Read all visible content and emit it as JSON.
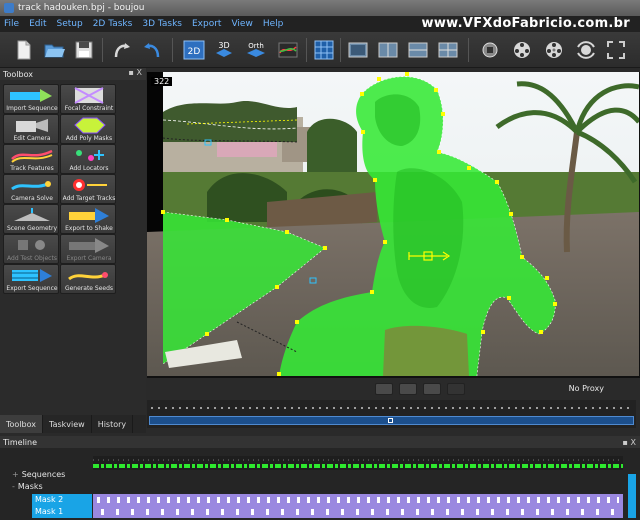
{
  "window": {
    "title": "track hadouken.bpj - boujou",
    "watermark": "www.VFXdoFabricio.com.br"
  },
  "menu": [
    "File",
    "Edit",
    "Setup",
    "2D Tasks",
    "3D Tasks",
    "Export",
    "View",
    "Help"
  ],
  "toolbar": {
    "buttons": [
      {
        "name": "new-icon",
        "label": ""
      },
      {
        "name": "open-icon",
        "label": ""
      },
      {
        "name": "save-icon",
        "label": ""
      },
      {
        "name": "undo-icon",
        "label": ""
      },
      {
        "name": "redo-icon",
        "label": ""
      },
      {
        "name": "view-2d-icon",
        "label": "2D"
      },
      {
        "name": "view-3d-icon",
        "label": "3D"
      },
      {
        "name": "view-orth-icon",
        "label": "Orth"
      },
      {
        "name": "graph-view-icon",
        "label": ""
      },
      {
        "name": "grid-view-icon",
        "label": ""
      },
      {
        "name": "layout-1-icon",
        "label": ""
      },
      {
        "name": "layout-2-icon",
        "label": ""
      },
      {
        "name": "layout-3-icon",
        "label": ""
      },
      {
        "name": "layout-4-icon",
        "label": ""
      },
      {
        "name": "camera-tool-icon",
        "label": ""
      },
      {
        "name": "film-reel-icon",
        "label": ""
      },
      {
        "name": "film-reel-2-icon",
        "label": ""
      },
      {
        "name": "orbit-icon",
        "label": ""
      },
      {
        "name": "frame-icon",
        "label": ""
      }
    ]
  },
  "toolbox": {
    "title": "Toolbox",
    "controls": "▪ X",
    "tools": [
      {
        "label": "Import Sequence",
        "color": "#2ec3ff",
        "disabled": false
      },
      {
        "label": "Focal Constraint",
        "color": "#c48cff",
        "disabled": false
      },
      {
        "label": "Edit Camera",
        "color": "#d8d8d8",
        "disabled": false
      },
      {
        "label": "Add Poly Masks",
        "color": "#c8f23a",
        "disabled": false
      },
      {
        "label": "Track Features",
        "color": "#ff4d6d",
        "disabled": false
      },
      {
        "label": "Add Locators",
        "color": "#38e07a",
        "disabled": false
      },
      {
        "label": "Camera Solve",
        "color": "#2ec3ff",
        "disabled": false
      },
      {
        "label": "Add Target Tracks",
        "color": "#ff3030",
        "disabled": false
      },
      {
        "label": "Scene Geometry",
        "color": "#bdbdbd",
        "disabled": false
      },
      {
        "label": "Export to Shake",
        "color": "#ffd23a",
        "disabled": false
      },
      {
        "label": "Add Test Objects",
        "color": "#8a8a8a",
        "disabled": true
      },
      {
        "label": "Export Camera",
        "color": "#8a8a8a",
        "disabled": true
      },
      {
        "label": "Export Sequence",
        "color": "#2ec3ff",
        "disabled": false
      },
      {
        "label": "Generate Seeds",
        "color": "#ffd23a",
        "disabled": false
      }
    ]
  },
  "left_tabs": [
    {
      "label": "Toolbox",
      "active": true
    },
    {
      "label": "Taskview",
      "active": false
    },
    {
      "label": "History",
      "active": false
    }
  ],
  "viewport": {
    "frame_number": "322",
    "proxy_label": "No Proxy"
  },
  "timeline": {
    "title": "Timeline",
    "controls": "▪ X",
    "tree": [
      {
        "label": "Sequences",
        "prefix": "+"
      },
      {
        "label": "Masks",
        "prefix": "-"
      }
    ],
    "masks": [
      "Mask 2",
      "Mask 1"
    ]
  },
  "colors": {
    "mask_green": "#2ee82e",
    "accent_blue": "#19a4e6",
    "timeline_purple": "#9a88e0"
  }
}
